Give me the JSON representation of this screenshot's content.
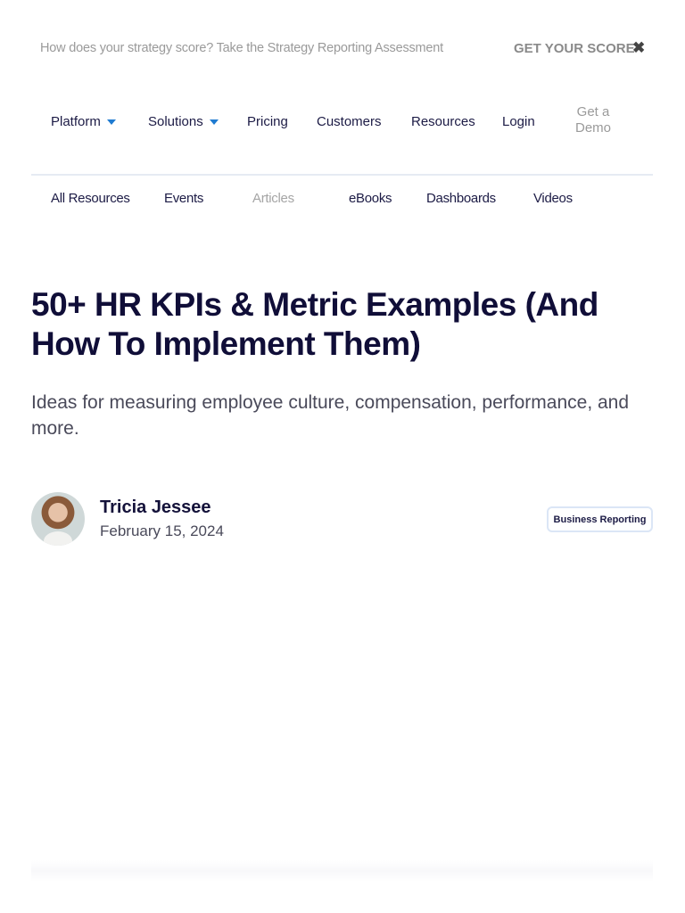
{
  "banner": {
    "message": "How does your strategy score? Take the Strategy Reporting Assessment",
    "cta": "GET YOUR SCORE",
    "close": "✖"
  },
  "nav": {
    "platform": "Platform",
    "solutions": "Solutions",
    "pricing": "Pricing",
    "customers": "Customers",
    "resources": "Resources",
    "login": "Login",
    "demo_line1": "Get a",
    "demo_line2": "Demo"
  },
  "subnav": {
    "all": "All Resources",
    "events": "Events",
    "articles": "Articles",
    "ebooks": "eBooks",
    "dashboards": "Dashboards",
    "videos": "Videos"
  },
  "article": {
    "title": "50+ HR KPIs & Metric Examples (And How To Implement Them)",
    "subtitle": "Ideas for measuring employee culture, compensation, performance, and more.",
    "author": "Tricia Jessee",
    "date": "February 15, 2024",
    "tag": "Business Reporting"
  }
}
